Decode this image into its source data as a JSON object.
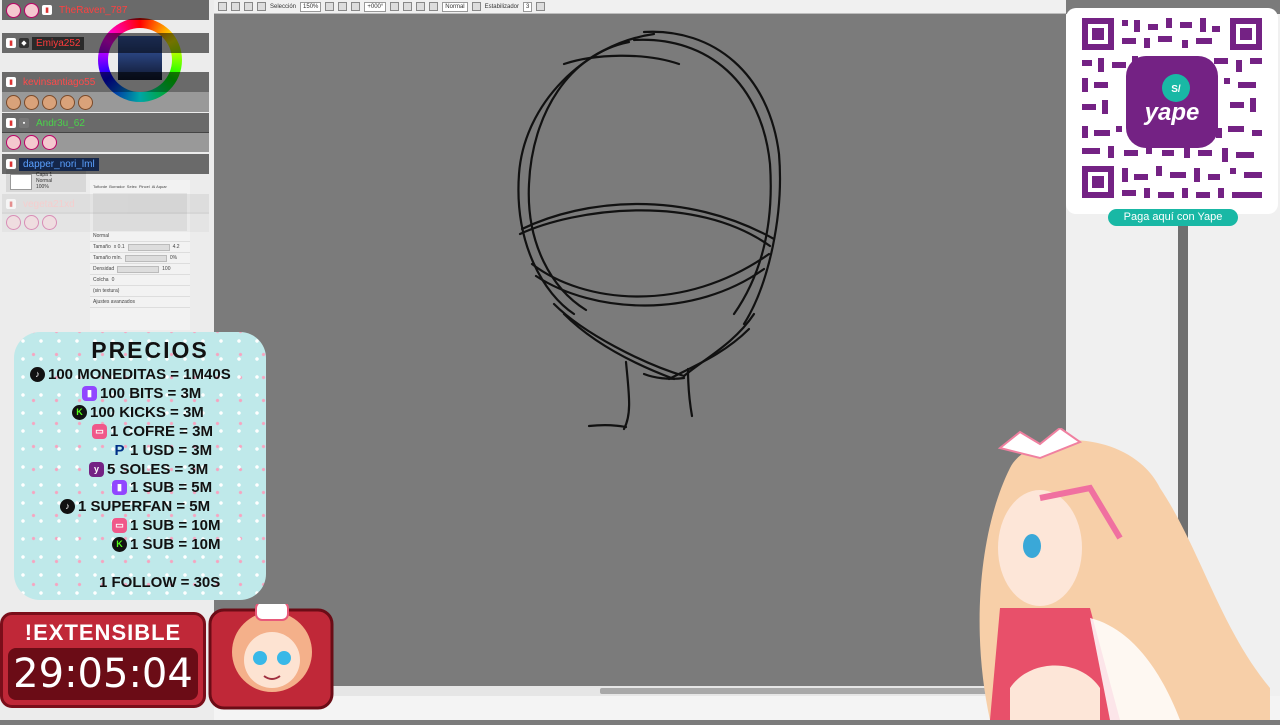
{
  "toolbar": {
    "selection_label": "Selección",
    "zoom": "150%",
    "rotation": "+000°",
    "blend_mode": "Normal",
    "stabilizer_label": "Estabilizador",
    "stabilizer_value": "3"
  },
  "chat": [
    {
      "user": "TheRaven_787",
      "color": "#ff4040"
    },
    {
      "user": "Emiya252",
      "color": "#ff3b3b"
    },
    {
      "user": "kevinsantiago55",
      "color": "#ff4a4a"
    },
    {
      "user": "Andr3u_62",
      "color": "#4ad44a"
    },
    {
      "user": "dapper_nori_lml",
      "color": "#5aa0ff"
    },
    {
      "user": "vegeta21xd",
      "color": "#ffb0b0"
    }
  ],
  "brush_panel": {
    "tools": [
      "Tofiorde",
      "Borrador",
      "Selec",
      "Pincel",
      "Ai Aquar"
    ],
    "mode": "Normal",
    "size_label": "Tamaño",
    "size_multiplier": "x 0.1",
    "size_value": "4.2",
    "min_size_label": "Tamaño mín.",
    "min_size_value": "0%",
    "density_label": "Densidad",
    "density_value": "100",
    "texture_label": "Colcha",
    "texture_value": "0",
    "no_texture": "(sin textura)",
    "advanced": "Ajustes avanzados",
    "layer_name": "Capa 1",
    "layer_mode": "Normal",
    "layer_opacity": "100%"
  },
  "prices": {
    "title": "PRECIOS",
    "lines": [
      {
        "icon": "tiktok-icon",
        "text": "100 MONEDITAS = 1M40S"
      },
      {
        "icon": "twitch-icon",
        "text": "100 BITS = 3M"
      },
      {
        "icon": "kick-icon",
        "text": "100 KICKS = 3M"
      },
      {
        "icon": "chest-icon",
        "text": "1 COFRE = 3M"
      },
      {
        "icon": "paypal-icon",
        "text": "1 USD = 3M"
      },
      {
        "icon": "yape-icon",
        "text": "5 SOLES = 3M"
      },
      {
        "icon": "twitch-icon",
        "text": "1 SUB = 5M"
      },
      {
        "icon": "tiktok-icon",
        "text": "1 SUPERFAN = 5M"
      },
      {
        "icon": "chest-icon",
        "text": "1 SUB = 10M"
      },
      {
        "icon": "kick-icon",
        "text": "1 SUB = 10M"
      }
    ],
    "follow": "1 FOLLOW = 30S"
  },
  "timer": {
    "label": "!EXTENSIBLE",
    "value": "29:05:04"
  },
  "yape": {
    "button": "Paga aquí con Yape",
    "brand": "yape",
    "currency": "S/"
  },
  "colors": {
    "canvas": "#7b7b7b",
    "yape_purple": "#742284",
    "yape_teal": "#19b8a5",
    "timer_red": "#c02838",
    "prices_bg": "#bfe9ea"
  }
}
